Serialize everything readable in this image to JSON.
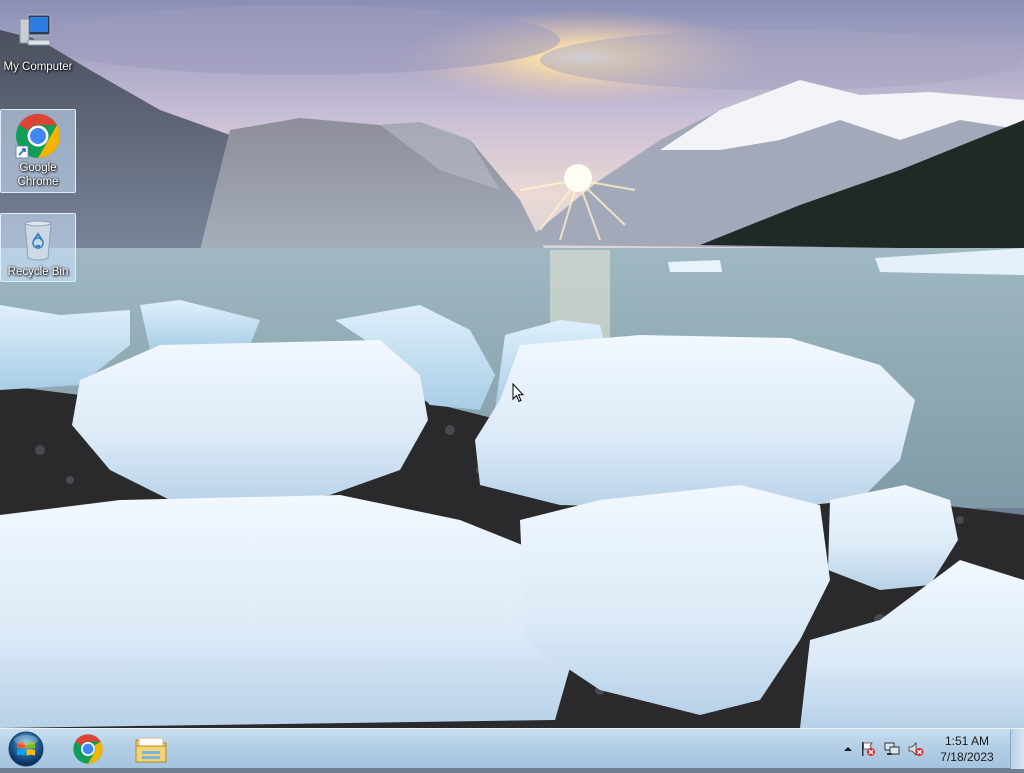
{
  "desktop": {
    "icons": [
      {
        "label": "My Computer",
        "icon": "computer-icon",
        "selected": false
      },
      {
        "label": "Google\nChrome",
        "label_line1": "Google",
        "label_line2": "Chrome",
        "icon": "chrome-icon",
        "selected": true
      },
      {
        "label": "Recycle Bin",
        "icon": "recycle-bin-icon",
        "selected": true
      }
    ]
  },
  "taskbar": {
    "start": {
      "icon": "windows-start-orb-icon"
    },
    "pinned": [
      {
        "name": "Google Chrome",
        "icon": "chrome-icon"
      },
      {
        "name": "Windows Explorer",
        "icon": "folder-explorer-icon"
      }
    ],
    "tray": {
      "icons": [
        "show-hidden-icons-arrow",
        "action-center-flag-icon",
        "network-icon",
        "volume-muted-icon"
      ],
      "time": "1:51 AM",
      "date": "7/18/2023"
    }
  },
  "colors": {
    "taskbar": "#b3cfe6",
    "selection": "#cde6ff",
    "chrome_red": "#db4437",
    "chrome_green": "#0f9d58",
    "chrome_yellow": "#f4b400",
    "chrome_blue": "#4285f4"
  }
}
